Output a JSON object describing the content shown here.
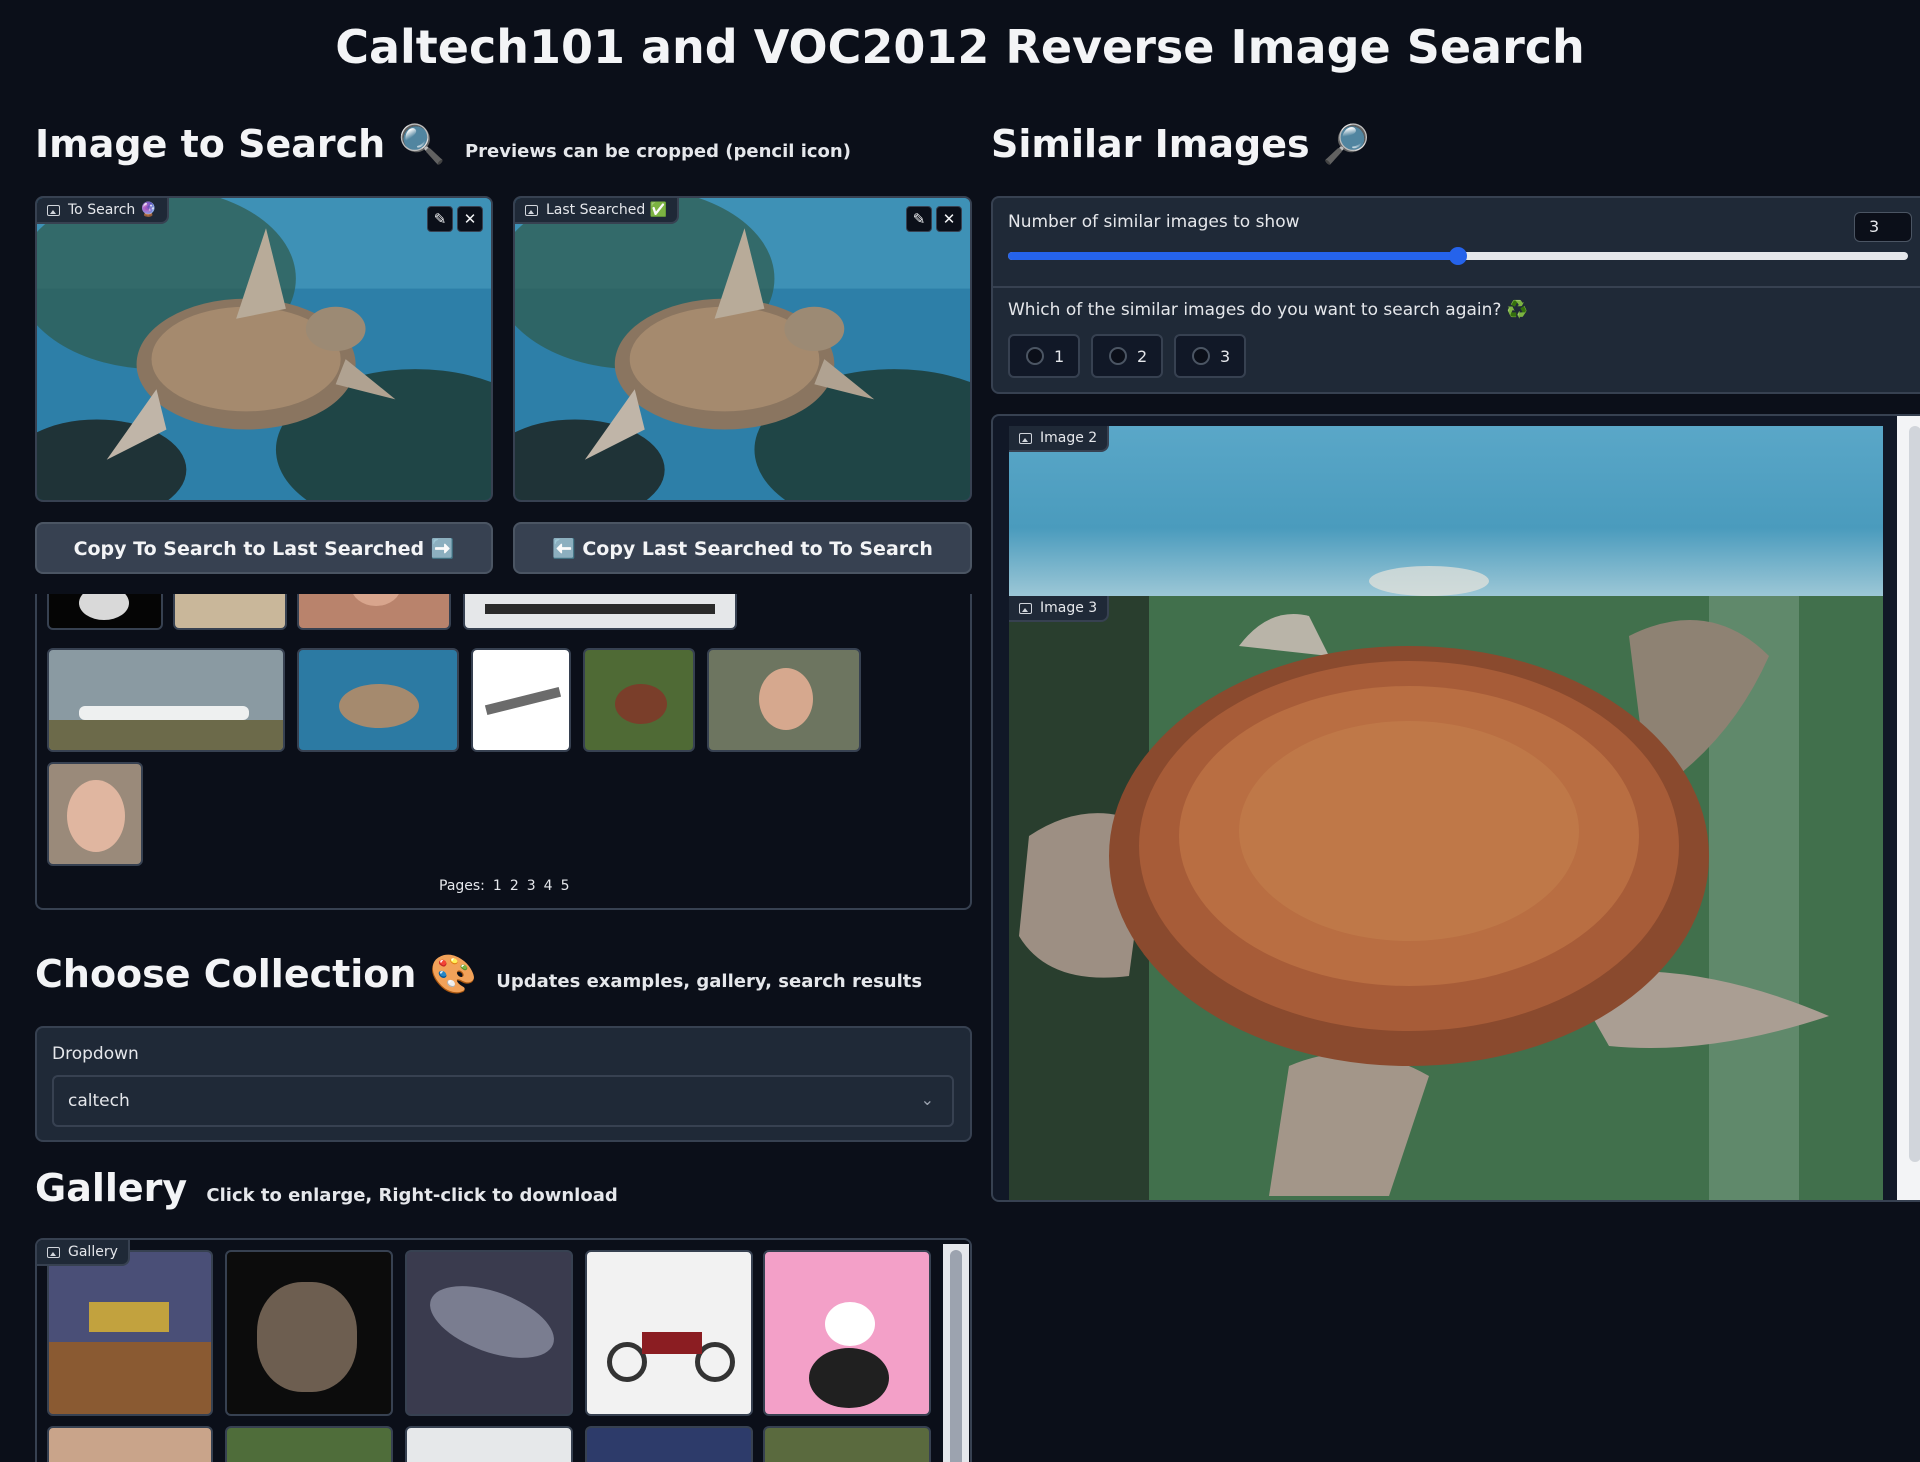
{
  "app_title": "Caltech101 and VOC2012 Reverse Image Search",
  "search_section": {
    "title": "Image to Search",
    "title_emoji": "🔍",
    "subtitle": "Previews can be cropped (pencil icon)",
    "to_search_label": "To Search 🔮",
    "last_searched_label": "Last Searched ✅",
    "copy_to_last_button": "Copy To Search to Last Searched ➡️",
    "copy_last_to_search_button": "⬅️ Copy Last Searched to To Search",
    "pages_label": "Pages:",
    "pages": [
      "1",
      "2",
      "3",
      "4",
      "5"
    ]
  },
  "collection_section": {
    "title": "Choose Collection",
    "title_emoji": "🎨",
    "subtitle": "Updates examples, gallery, search results",
    "dropdown_label": "Dropdown",
    "dropdown_value": "caltech"
  },
  "gallery_section": {
    "title": "Gallery",
    "subtitle": "Click to enlarge, Right-click to download",
    "panel_label": "Gallery"
  },
  "similar_section": {
    "title": "Similar Images",
    "title_emoji": "🔎",
    "slider_label": "Number of similar images to show",
    "slider_value": "3",
    "slider_fraction": 0.5,
    "search_again_label": "Which of the similar images do you want to search again? ♻️",
    "options": [
      "1",
      "2",
      "3"
    ],
    "image2_label": "Image 2",
    "image3_label": "Image 3"
  },
  "colors": {
    "background": "#0b0f19",
    "panel": "#1f2937",
    "border": "#374151",
    "slider_accent": "#2563eb"
  }
}
